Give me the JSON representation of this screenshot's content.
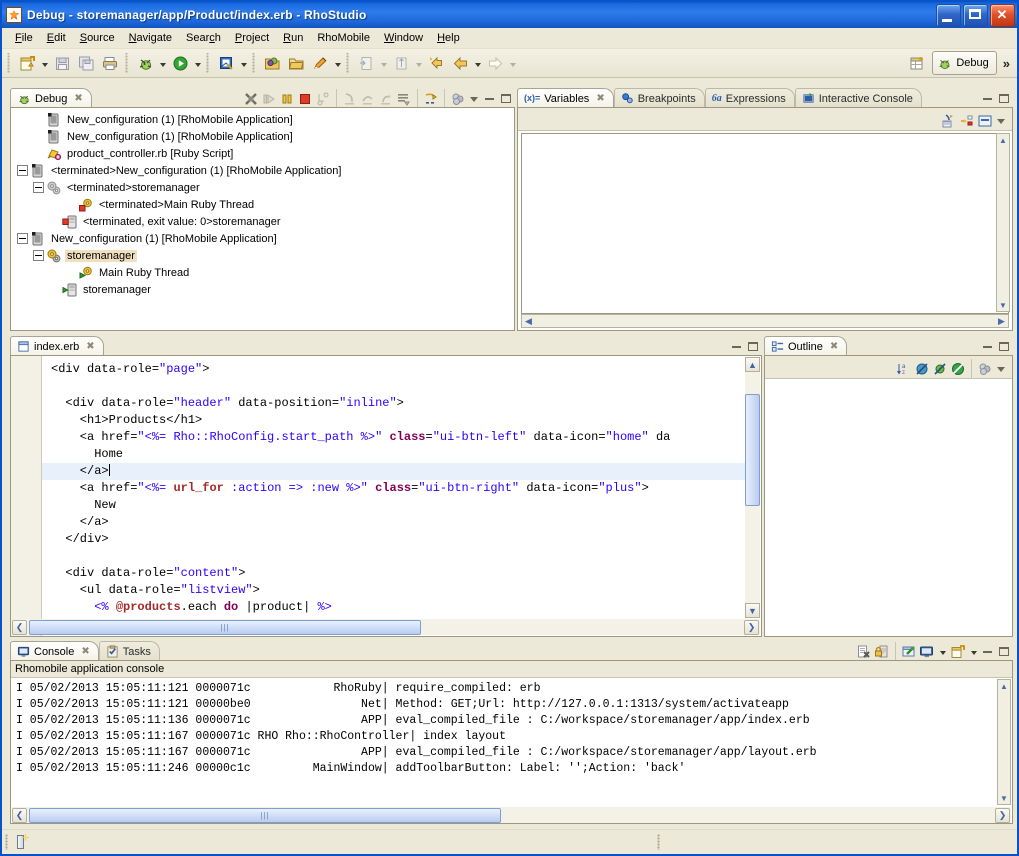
{
  "window": {
    "title": "Debug - storemanager/app/Product/index.erb - RhoStudio",
    "app_icon": "rhostudio-icon",
    "buttons": {
      "minimize": "_",
      "maximize": "□",
      "close": "✕"
    }
  },
  "menubar": {
    "items": [
      {
        "label": "File",
        "accel": "F"
      },
      {
        "label": "Edit",
        "accel": "E"
      },
      {
        "label": "Source",
        "accel": "S"
      },
      {
        "label": "Navigate",
        "accel": "N"
      },
      {
        "label": "Search",
        "accel": "c"
      },
      {
        "label": "Project",
        "accel": "P"
      },
      {
        "label": "Run",
        "accel": "R"
      },
      {
        "label": "RhoMobile",
        "accel": ""
      },
      {
        "label": "Window",
        "accel": "W"
      },
      {
        "label": "Help",
        "accel": "H"
      }
    ]
  },
  "toolbar": {
    "buttons": [
      "new-wizard-icon",
      "save-icon",
      "save-all-icon",
      "print-icon",
      "debug-icon",
      "run-icon",
      "external-tools-icon",
      "open-type-icon",
      "open-resource-icon",
      "marker-icon",
      "next-annotation-icon",
      "previous-annotation-icon",
      "last-edit-location-icon",
      "back-icon",
      "forward-icon"
    ],
    "perspective_switch_icon": "open-perspective-icon",
    "perspective_label": "Debug",
    "perspective_icon": "debug-perspective-icon",
    "overflow_chevron": "»"
  },
  "debug_view": {
    "tab_label": "Debug",
    "tab_icon": "debug-icon",
    "toolbar_icons": [
      "disconnect-icon",
      "resume-icon",
      "suspend-icon",
      "terminate-icon",
      "step-into-selection-icon",
      "step-into-icon",
      "step-over-icon",
      "step-return-icon",
      "drop-to-frame-icon",
      "use-step-filters-icon",
      "view-menu-icon"
    ],
    "tree": [
      {
        "indent": 1,
        "expander": "",
        "icon": "launch-config-icon",
        "label": "New_configuration (1) [RhoMobile Application]",
        "selected": false
      },
      {
        "indent": 1,
        "expander": "",
        "icon": "launch-config-icon",
        "label": "New_configuration (1) [RhoMobile Application]",
        "selected": false
      },
      {
        "indent": 1,
        "expander": "",
        "icon": "ruby-script-icon",
        "label": "product_controller.rb [Ruby Script]",
        "selected": false
      },
      {
        "indent": 0,
        "expander": "minus",
        "icon": "launch-config-icon",
        "label": "<terminated>New_configuration (1) [RhoMobile Application]",
        "selected": false
      },
      {
        "indent": 1,
        "expander": "minus",
        "icon": "gears-gray-icon",
        "label": "<terminated>storemanager",
        "selected": false
      },
      {
        "indent": 3,
        "expander": "",
        "icon": "thread-terminated-icon",
        "label": "<terminated>Main Ruby Thread",
        "selected": false
      },
      {
        "indent": 2,
        "expander": "",
        "icon": "process-terminated-icon",
        "label": "<terminated, exit value: 0>storemanager",
        "selected": false
      },
      {
        "indent": 0,
        "expander": "minus",
        "icon": "launch-config-icon",
        "label": "New_configuration (1) [RhoMobile Application]",
        "selected": false
      },
      {
        "indent": 1,
        "expander": "minus",
        "icon": "gears-icon",
        "label": "storemanager",
        "selected": true
      },
      {
        "indent": 3,
        "expander": "",
        "icon": "thread-running-icon",
        "label": "Main Ruby Thread",
        "selected": false
      },
      {
        "indent": 2,
        "expander": "",
        "icon": "process-running-icon",
        "label": "storemanager",
        "selected": false
      }
    ]
  },
  "variables_view": {
    "tabs": [
      {
        "label": "Variables",
        "icon": "variables-icon",
        "active": true,
        "closeable": true
      },
      {
        "label": "Breakpoints",
        "icon": "breakpoints-icon",
        "active": false,
        "closeable": false
      },
      {
        "label": "Expressions",
        "icon": "expressions-icon",
        "active": false,
        "closeable": false
      },
      {
        "label": "Interactive Console",
        "icon": "interactive-console-icon",
        "active": false,
        "closeable": false
      }
    ],
    "toolbar_icons": [
      "show-logical-structure-icon",
      "collapse-all-icon",
      "layout-icon",
      "view-menu-icon"
    ],
    "content": ""
  },
  "editor": {
    "tab_label": "index.erb",
    "tab_icon": "erb-file-icon",
    "lines": [
      {
        "cursor": false,
        "tokens": [
          {
            "t": "<div data-role=",
            "c": "plain"
          },
          {
            "t": "\"page\"",
            "c": "str"
          },
          {
            "t": ">",
            "c": "plain"
          }
        ]
      },
      {
        "cursor": false,
        "tokens": []
      },
      {
        "cursor": false,
        "tokens": [
          {
            "t": "  <div data-role=",
            "c": "plain"
          },
          {
            "t": "\"header\"",
            "c": "str"
          },
          {
            "t": " data-position=",
            "c": "plain"
          },
          {
            "t": "\"inline\"",
            "c": "str"
          },
          {
            "t": ">",
            "c": "plain"
          }
        ]
      },
      {
        "cursor": false,
        "tokens": [
          {
            "t": "    <h1>Products</h1>",
            "c": "plain"
          }
        ]
      },
      {
        "cursor": false,
        "tokens": [
          {
            "t": "    <a href=",
            "c": "plain"
          },
          {
            "t": "\"<%= ",
            "c": "str"
          },
          {
            "t": "Rho::RhoConfig.start_path",
            "c": "str"
          },
          {
            "t": " %>\"",
            "c": "str"
          },
          {
            "t": " ",
            "c": "plain"
          },
          {
            "t": "class",
            "c": "attr"
          },
          {
            "t": "=",
            "c": "plain"
          },
          {
            "t": "\"ui-btn-left\"",
            "c": "str"
          },
          {
            "t": " data-icon=",
            "c": "plain"
          },
          {
            "t": "\"home\"",
            "c": "str"
          },
          {
            "t": " da",
            "c": "plain"
          }
        ]
      },
      {
        "cursor": false,
        "tokens": [
          {
            "t": "      Home",
            "c": "plain"
          }
        ]
      },
      {
        "cursor": true,
        "tokens": [
          {
            "t": "    </a>",
            "c": "plain"
          }
        ]
      },
      {
        "cursor": false,
        "tokens": [
          {
            "t": "    <a href=",
            "c": "plain"
          },
          {
            "t": "\"<%= ",
            "c": "str"
          },
          {
            "t": "url_for",
            "c": "var"
          },
          {
            "t": " :action => :new",
            "c": "str"
          },
          {
            "t": " %>\"",
            "c": "str"
          },
          {
            "t": " ",
            "c": "plain"
          },
          {
            "t": "class",
            "c": "attr"
          },
          {
            "t": "=",
            "c": "plain"
          },
          {
            "t": "\"ui-btn-right\"",
            "c": "str"
          },
          {
            "t": " data-icon=",
            "c": "plain"
          },
          {
            "t": "\"plus\"",
            "c": "str"
          },
          {
            "t": ">",
            "c": "plain"
          }
        ]
      },
      {
        "cursor": false,
        "tokens": [
          {
            "t": "      New",
            "c": "plain"
          }
        ]
      },
      {
        "cursor": false,
        "tokens": [
          {
            "t": "    </a>",
            "c": "plain"
          }
        ]
      },
      {
        "cursor": false,
        "tokens": [
          {
            "t": "  </div>",
            "c": "plain"
          }
        ]
      },
      {
        "cursor": false,
        "tokens": []
      },
      {
        "cursor": false,
        "tokens": [
          {
            "t": "  <div data-role=",
            "c": "plain"
          },
          {
            "t": "\"content\"",
            "c": "str"
          },
          {
            "t": ">",
            "c": "plain"
          }
        ]
      },
      {
        "cursor": false,
        "tokens": [
          {
            "t": "    <ul data-role=",
            "c": "plain"
          },
          {
            "t": "\"listview\"",
            "c": "str"
          },
          {
            "t": ">",
            "c": "plain"
          }
        ]
      },
      {
        "cursor": false,
        "tokens": [
          {
            "t": "      ",
            "c": "plain"
          },
          {
            "t": "<% ",
            "c": "erb"
          },
          {
            "t": "@products",
            "c": "var"
          },
          {
            "t": ".each ",
            "c": "plain"
          },
          {
            "t": "do",
            "c": "kw"
          },
          {
            "t": " |product| ",
            "c": "plain"
          },
          {
            "t": "%>",
            "c": "erb"
          }
        ]
      }
    ]
  },
  "outline_view": {
    "tab_label": "Outline",
    "tab_icon": "outline-icon",
    "toolbar_icons": [
      "sort-icon",
      "hide-nonpublic-icon",
      "hide-static-icon",
      "hide-fields-icon",
      "link-with-editor-icon",
      "view-menu-icon"
    ],
    "content": ""
  },
  "console_view": {
    "tabs": [
      {
        "label": "Console",
        "icon": "console-icon",
        "active": true,
        "closeable": true
      },
      {
        "label": "Tasks",
        "icon": "tasks-icon",
        "active": false,
        "closeable": false
      }
    ],
    "subtitle": "Rhomobile application console",
    "toolbar_icons": [
      "clear-console-icon",
      "lock-scroll-icon",
      "pin-console-icon",
      "display-console-icon",
      "open-console-icon"
    ],
    "lines": [
      "I 05/02/2013 15:05:11:121 0000071c            RhoRuby| require_compiled: erb",
      "I 05/02/2013 15:05:11:121 00000be0                Net| Method: GET;Url: http://127.0.0.1:1313/system/activateapp",
      "I 05/02/2013 15:05:11:136 0000071c                APP| eval_compiled_file : C:/workspace/storemanager/app/index.erb",
      "I 05/02/2013 15:05:11:167 0000071c RHO Rho::RhoController| index layout",
      "I 05/02/2013 15:05:11:167 0000071c                APP| eval_compiled_file : C:/workspace/storemanager/app/layout.erb",
      "I 05/02/2013 15:05:11:246 00000c1c         MainWindow| addToolbarButton: Label: '';Action: 'back'"
    ]
  },
  "statusbar": {
    "icon": "writable-indicator-icon",
    "text": ""
  },
  "colors": {
    "title_blue": "#0a5ad4",
    "chrome": "#ece9d8",
    "selection": "#f0e0c0",
    "string_blue": "#2a00ff",
    "attr_magenta": "#7f0055",
    "var_brown": "#a52a2a",
    "current_line": "#e8f0fb"
  }
}
